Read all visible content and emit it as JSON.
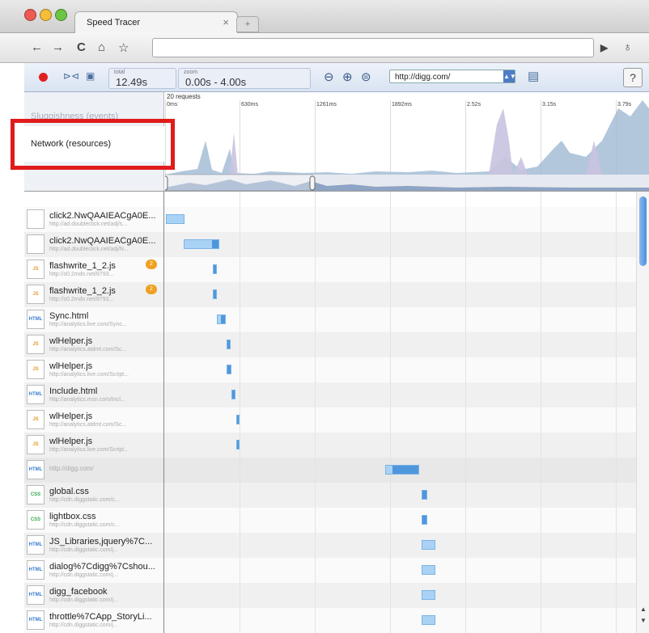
{
  "window": {
    "tab_title": "Speed Tracer",
    "tab_close": "×",
    "new_tab": "+"
  },
  "nav": {
    "back": "←",
    "forward": "→",
    "reload": "C",
    "home": "⌂",
    "star": "☆",
    "address": "",
    "go": "▶",
    "wrench": "♁"
  },
  "toolbar": {
    "total_label": "total",
    "total_value": "12.49s",
    "zoom_label": "zoom",
    "zoom_value": "0.00s - 4.00s",
    "url_select": "http://digg.com/",
    "help": "?"
  },
  "overview": {
    "sluggishness_label": "Sluggishness (events)",
    "network_label": "Network (resources)",
    "request_count": "20 requests",
    "ticks": [
      "0ms",
      "630ms",
      "1261ms",
      "1892ms",
      "2.52s",
      "3.15s",
      "3.79s"
    ]
  },
  "resources": [
    {
      "name": "click2.NwQAAIEACgA0E...",
      "url": "http://ad.doubleclick.net/adj/s...",
      "icon": "blank",
      "badge": "",
      "bar_start": 0.3,
      "bar_len": 4.0,
      "bar_fill": 0.0
    },
    {
      "name": "click2.NwQAAIEACgA0E...",
      "url": "http://ad.doubleclick.net/adj/N...",
      "icon": "blank",
      "badge": "",
      "bar_start": 4.2,
      "bar_len": 7.5,
      "bar_fill": 0.2
    },
    {
      "name": "flashwrite_1_2.js",
      "url": "http://s0.2mdn.net/8793...",
      "icon": "JS",
      "badge": "2",
      "bar_start": 10.3,
      "bar_len": 0.9,
      "bar_fill": 1.0
    },
    {
      "name": "flashwrite_1_2.js",
      "url": "http://s0.2mdn.net/8793...",
      "icon": "JS",
      "badge": "2",
      "bar_start": 10.3,
      "bar_len": 0.9,
      "bar_fill": 1.0
    },
    {
      "name": "Sync.html",
      "url": "http://analytics.live.com/Sync...",
      "icon": "HTML",
      "badge": "",
      "bar_start": 11.2,
      "bar_len": 1.8,
      "bar_fill": 0.6
    },
    {
      "name": "wlHelper.js",
      "url": "http://analytics.atdmt.com/Sc...",
      "icon": "JS",
      "badge": "",
      "bar_start": 13.2,
      "bar_len": 0.9,
      "bar_fill": 1.0
    },
    {
      "name": "wlHelper.js",
      "url": "http://analytics.live.com/Script...",
      "icon": "JS",
      "badge": "",
      "bar_start": 13.2,
      "bar_len": 1.0,
      "bar_fill": 1.0
    },
    {
      "name": "Include.html",
      "url": "http://analytics.msn.com/Incl...",
      "icon": "HTML",
      "badge": "",
      "bar_start": 14.2,
      "bar_len": 0.9,
      "bar_fill": 1.0
    },
    {
      "name": "wlHelper.js",
      "url": "http://analytics.atdmt.com/Sc...",
      "icon": "JS",
      "badge": "",
      "bar_start": 15.2,
      "bar_len": 0.8,
      "bar_fill": 1.0
    },
    {
      "name": "wlHelper.js",
      "url": "http://analytics.live.com/Script...",
      "icon": "JS",
      "badge": "",
      "bar_start": 15.2,
      "bar_len": 0.8,
      "bar_fill": 1.0
    },
    {
      "name": "",
      "url": "http://digg.com/",
      "icon": "HTML",
      "badge": "",
      "bar_start": 46.8,
      "bar_len": 7.2,
      "bar_fill": 0.8
    },
    {
      "name": "global.css",
      "url": "http://cdn.diggstatic.com/c...",
      "icon": "CSS",
      "badge": "",
      "bar_start": 54.5,
      "bar_len": 1.2,
      "bar_fill": 1.0
    },
    {
      "name": "lightbox.css",
      "url": "http://cdn.diggstatic.com/c...",
      "icon": "CSS",
      "badge": "",
      "bar_start": 54.5,
      "bar_len": 1.2,
      "bar_fill": 1.0
    },
    {
      "name": "JS_Libraries,jquery%7C...",
      "url": "http://cdn.diggstatic.com/j...",
      "icon": "HTML",
      "badge": "",
      "bar_start": 54.5,
      "bar_len": 3.0,
      "bar_fill": 0.0
    },
    {
      "name": "dialog%7Cdigg%7Cshou...",
      "url": "http://cdn.diggstatic.com/j...",
      "icon": "HTML",
      "badge": "",
      "bar_start": 54.5,
      "bar_len": 3.0,
      "bar_fill": 0.0
    },
    {
      "name": "digg_facebook",
      "url": "http://cdn.diggstatic.com/j...",
      "icon": "HTML",
      "badge": "",
      "bar_start": 54.5,
      "bar_len": 3.0,
      "bar_fill": 0.0
    },
    {
      "name": "throttle%7CApp_StoryLi...",
      "url": "http://cdn.diggstatic.com/j...",
      "icon": "HTML",
      "badge": "",
      "bar_start": 54.5,
      "bar_len": 3.0,
      "bar_fill": 0.0
    }
  ]
}
